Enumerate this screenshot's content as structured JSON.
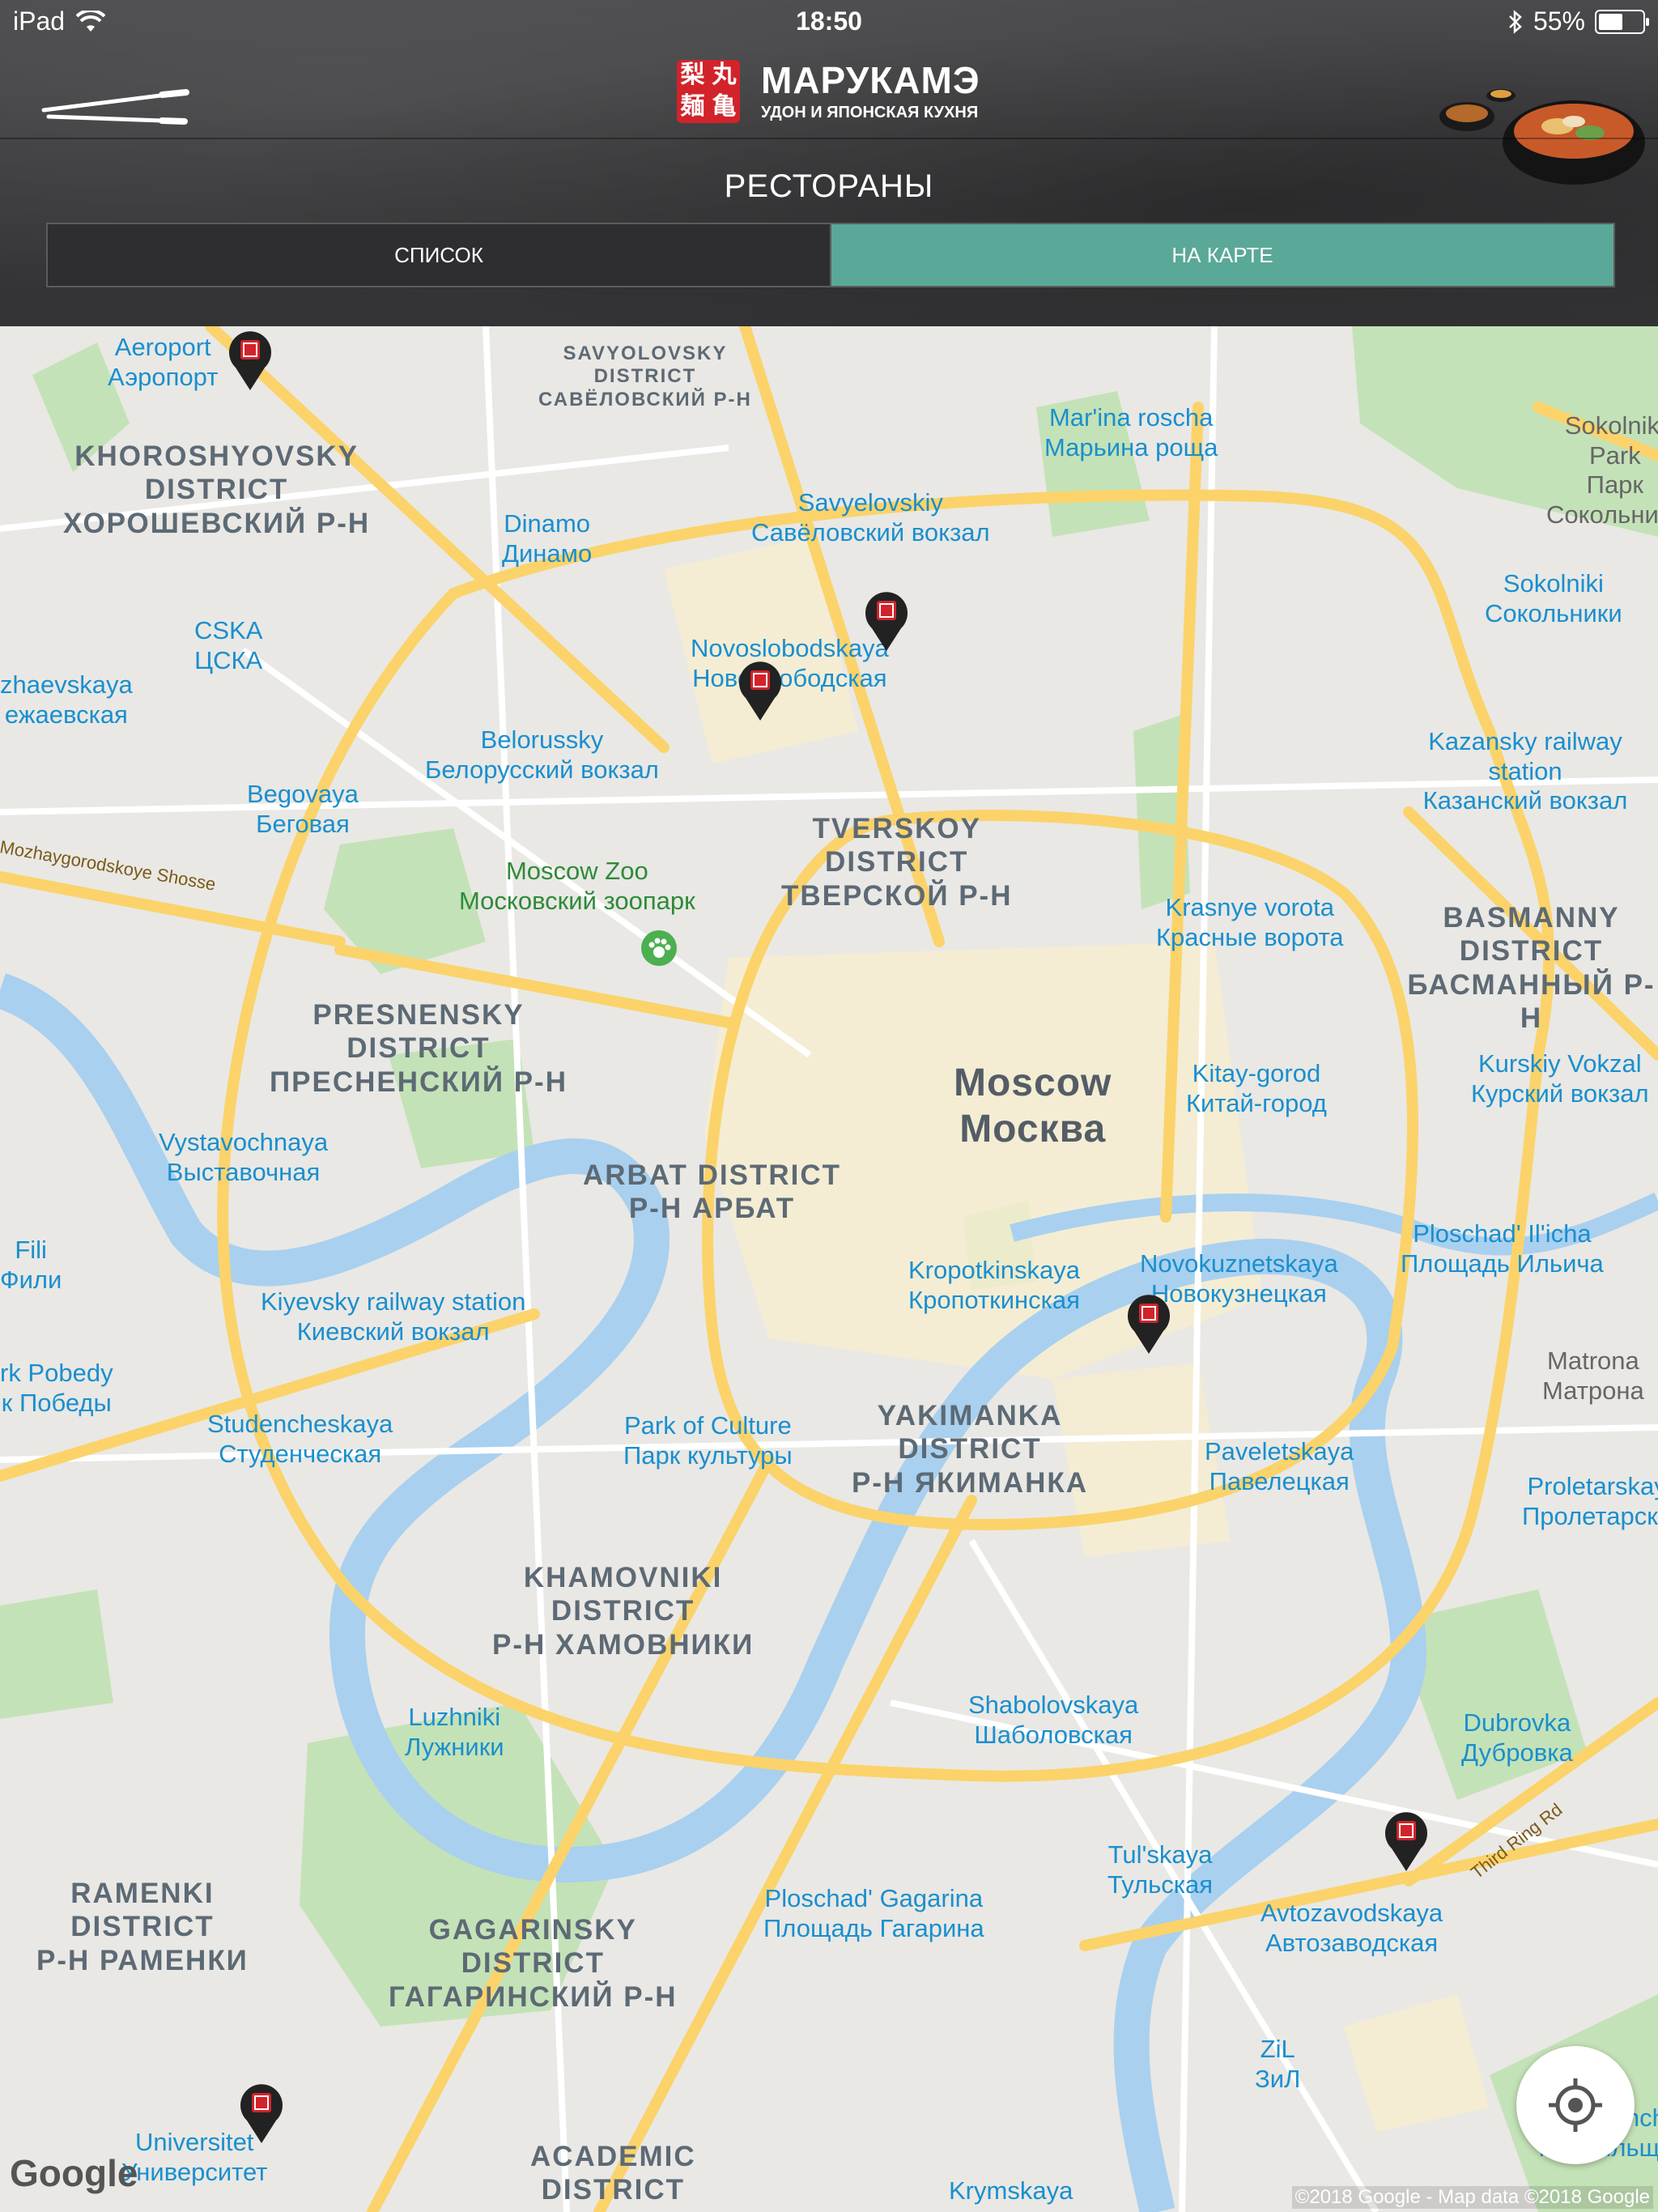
{
  "status_bar": {
    "device": "iPad",
    "time": "18:50",
    "battery_percent_label": "55%",
    "battery_level": 0.55
  },
  "brand": {
    "logo_chars": [
      "梨",
      "丸",
      "麺",
      "亀"
    ],
    "name": "МАРУКАМЭ",
    "subtitle": "УДОН И ЯПОНСКАЯ КУХНЯ"
  },
  "page": {
    "title": "РЕСТОРАНЫ",
    "tabs": [
      {
        "label": "СПИСОК",
        "selected": false
      },
      {
        "label": "НА КАРТЕ",
        "selected": true
      }
    ]
  },
  "colors": {
    "accent_tab": "#5aa998",
    "pin": "#222222",
    "pin_logo": "#d2232a",
    "road": "#fbd36a",
    "river": "#a9d0ef",
    "park": "#c4e2b7",
    "metro_label": "#1a8fcf"
  },
  "map": {
    "metro_labels": [
      "Aeroport\nАэропорт",
      "Mar'ina roscha\nМарьина роща",
      "Savyelovskiy\nСавёловский вокзал",
      "Dinamo\nДинамо",
      "CSKA\nЦСКА",
      "Novoslobodskaya\nНовослободская",
      "Belorussky\nБелорусский вокзал",
      "Begovaya\nБеговая",
      "Krasnye vorota\nКрасные ворота",
      "Kazansky railway station\nКазанский вокзал",
      "Sokolniki\nСокольники",
      "Kitay-gorod\nКитай-город",
      "Kurskiy Vokzal\nКурский вокзал",
      "Vystavochnaya\nВыставочная",
      "Fili\nФили",
      "Kiyevsky railway station\nКиевский вокзал",
      "Studencheskaya\nСтуденческая",
      "Kropotkinskaya\nКропоткинская",
      "Novokuznetskaya\nНовокузнецкая",
      "Ploschad' Il'icha\nПлощадь Ильича",
      "Park of Culture\nПарк культуры",
      "Paveletskaya\nПавелецкая",
      "Proletarskaya\nПролетарская",
      "Shabolovskaya\nШаболовская",
      "Dubrovka\nДубровка",
      "Luzhniki\nЛужники",
      "Tul'skaya\nТульская",
      "Ploschad' Gagarina\nПлощадь Гагарина",
      "Avtozavodskaya\nАвтозаводская",
      "ZiL\nЗиЛ",
      "Universitet\nУниверситет",
      "Krymskaya",
      "zhaevskaya\nежаевская",
      "rk Pobedy\nк Победы",
      "Tekstilshchiki\nТекстильщики"
    ],
    "district_labels": [
      "SAVYOLOVSKY\nDISTRICT\nСАВЁЛОВСКИЙ Р-Н",
      "KHOROSHYOVSKY\nDISTRICT\nХОРОШЕВСКИЙ Р-Н",
      "TVERSKOY\nDISTRICT\nТВЕРСКОЙ Р-Н",
      "BASMANNY\nDISTRICT\nБАСМАННЫЙ Р-Н",
      "PRESNENSKY\nDISTRICT\nПРЕСНЕНСКИЙ Р-Н",
      "ARBAT DISTRICT\nР-Н АРБАТ",
      "YAKIMANKA\nDISTRICT\nР-Н ЯКИМАНКА",
      "KHAMOVNIKI\nDISTRICT\nР-Н ХАМОВНИКИ",
      "RAMENKI\nDISTRICT\nР-Н РАМЕНКИ",
      "GAGARINSKY\nDISTRICT\nГАГАРИНСКИЙ Р-Н",
      "ACADEMIC\nDISTRICT"
    ],
    "city_label": "Moscow\nМосква",
    "park_labels": [
      "Moscow Zoo\nМосковский зоопарк",
      "Sokolniki Park\nПарк\nСокольники",
      "Matrona\nМатрона"
    ],
    "road_labels": [
      "Mozhaygorodskoye Shosse",
      "Third Ring Rd"
    ],
    "restaurant_pin_count": 6,
    "google_logo": "Google",
    "attribution": "©2018 Google - Map data ©2018 Google"
  }
}
